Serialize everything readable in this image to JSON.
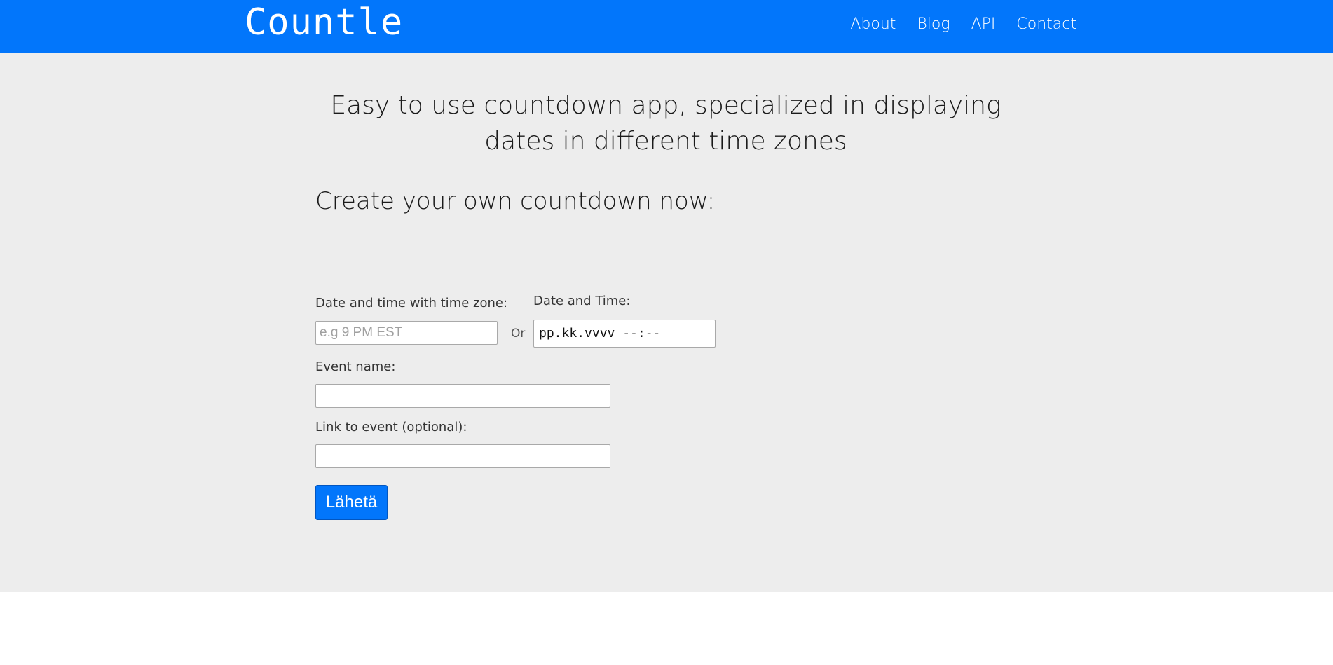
{
  "navbar": {
    "brand": "Countle",
    "links": [
      "About",
      "Blog",
      "API",
      "Contact"
    ]
  },
  "hero": {
    "tagline": "Easy to use countdown app, specialized in displaying dates in different time zones"
  },
  "form": {
    "title": "Create your own countdown now:",
    "timezone_label": "Date and time with time zone:",
    "timezone_placeholder": "e.g 9 PM EST",
    "or_text": "Or",
    "datetime_label": "Date and Time:",
    "datetime_value": "pp.kk.vvvv --:--",
    "event_name_label": "Event name:",
    "event_name_value": "",
    "link_label": "Link to event (optional):",
    "link_value": "",
    "submit_label": "Lähetä"
  },
  "colors": {
    "primary": "#0276fb",
    "page_background": "#ededed"
  }
}
